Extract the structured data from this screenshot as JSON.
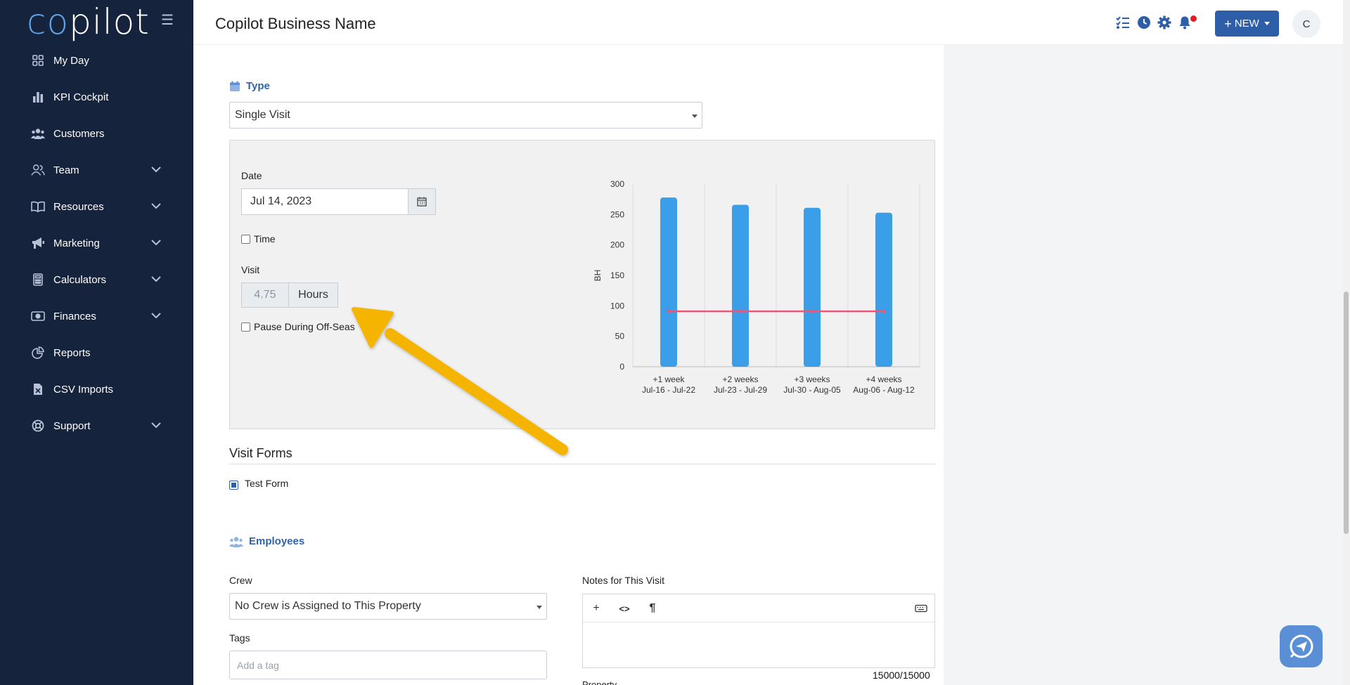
{
  "app": {
    "logo_co": "co",
    "logo_rest": "pilot",
    "business_name": "Copilot Business Name"
  },
  "sidebar": {
    "items": [
      {
        "label": "My Day",
        "icon": "grid-icon",
        "expandable": false
      },
      {
        "label": "KPI Cockpit",
        "icon": "bar-chart-icon",
        "expandable": false
      },
      {
        "label": "Customers",
        "icon": "users-icon",
        "expandable": false
      },
      {
        "label": "Team",
        "icon": "user-group-icon",
        "expandable": true
      },
      {
        "label": "Resources",
        "icon": "book-icon",
        "expandable": true
      },
      {
        "label": "Marketing",
        "icon": "megaphone-icon",
        "expandable": true
      },
      {
        "label": "Calculators",
        "icon": "calculator-icon",
        "expandable": true
      },
      {
        "label": "Finances",
        "icon": "money-icon",
        "expandable": true
      },
      {
        "label": "Reports",
        "icon": "pie-chart-icon",
        "expandable": false
      },
      {
        "label": "CSV Imports",
        "icon": "file-csv-icon",
        "expandable": false
      },
      {
        "label": "Support",
        "icon": "lifebuoy-icon",
        "expandable": true
      }
    ]
  },
  "topbar": {
    "new_label": "NEW",
    "avatar_initial": "C"
  },
  "form": {
    "type_heading": "Type",
    "type_value": "Single Visit",
    "date_label": "Date",
    "date_value": "Jul 14, 2023",
    "time_label": "Time",
    "visit_label": "Visit",
    "visit_hours": "4.75",
    "visit_unit": "Hours",
    "pause_label": "Pause During Off-Seas",
    "visit_forms_heading": "Visit Forms",
    "test_form_label": "Test Form",
    "employees_heading": "Employees",
    "crew_label": "Crew",
    "crew_value": "No Crew is Assigned to This Property",
    "tags_label": "Tags",
    "tags_placeholder": "Add a tag",
    "notes_label": "Notes for This Visit",
    "notes_counter": "15000/15000",
    "property_label": "Property"
  },
  "chart_data": {
    "type": "bar",
    "categories": [
      "+1 week",
      "+2 weeks",
      "+3 weeks",
      "+4 weeks"
    ],
    "category_sublabels": [
      "Jul-16 - Jul-22",
      "Jul-23 - Jul-29",
      "Jul-30 - Aug-05",
      "Aug-06 - Aug-12"
    ],
    "series": [
      {
        "type": "bar",
        "values": [
          278,
          266,
          261,
          253
        ],
        "color": "#3a9ee8"
      },
      {
        "type": "line",
        "values": [
          91,
          91,
          91,
          91
        ],
        "color": "#e8577a"
      }
    ],
    "ylabel": "BH",
    "ylim": [
      0,
      300
    ],
    "yticks": [
      0,
      50,
      100,
      150,
      200,
      250,
      300
    ],
    "grid": true
  },
  "colors": {
    "sidebar_bg": "#16233c",
    "accent": "#2f5ea8",
    "arrow": "#f5b400"
  }
}
